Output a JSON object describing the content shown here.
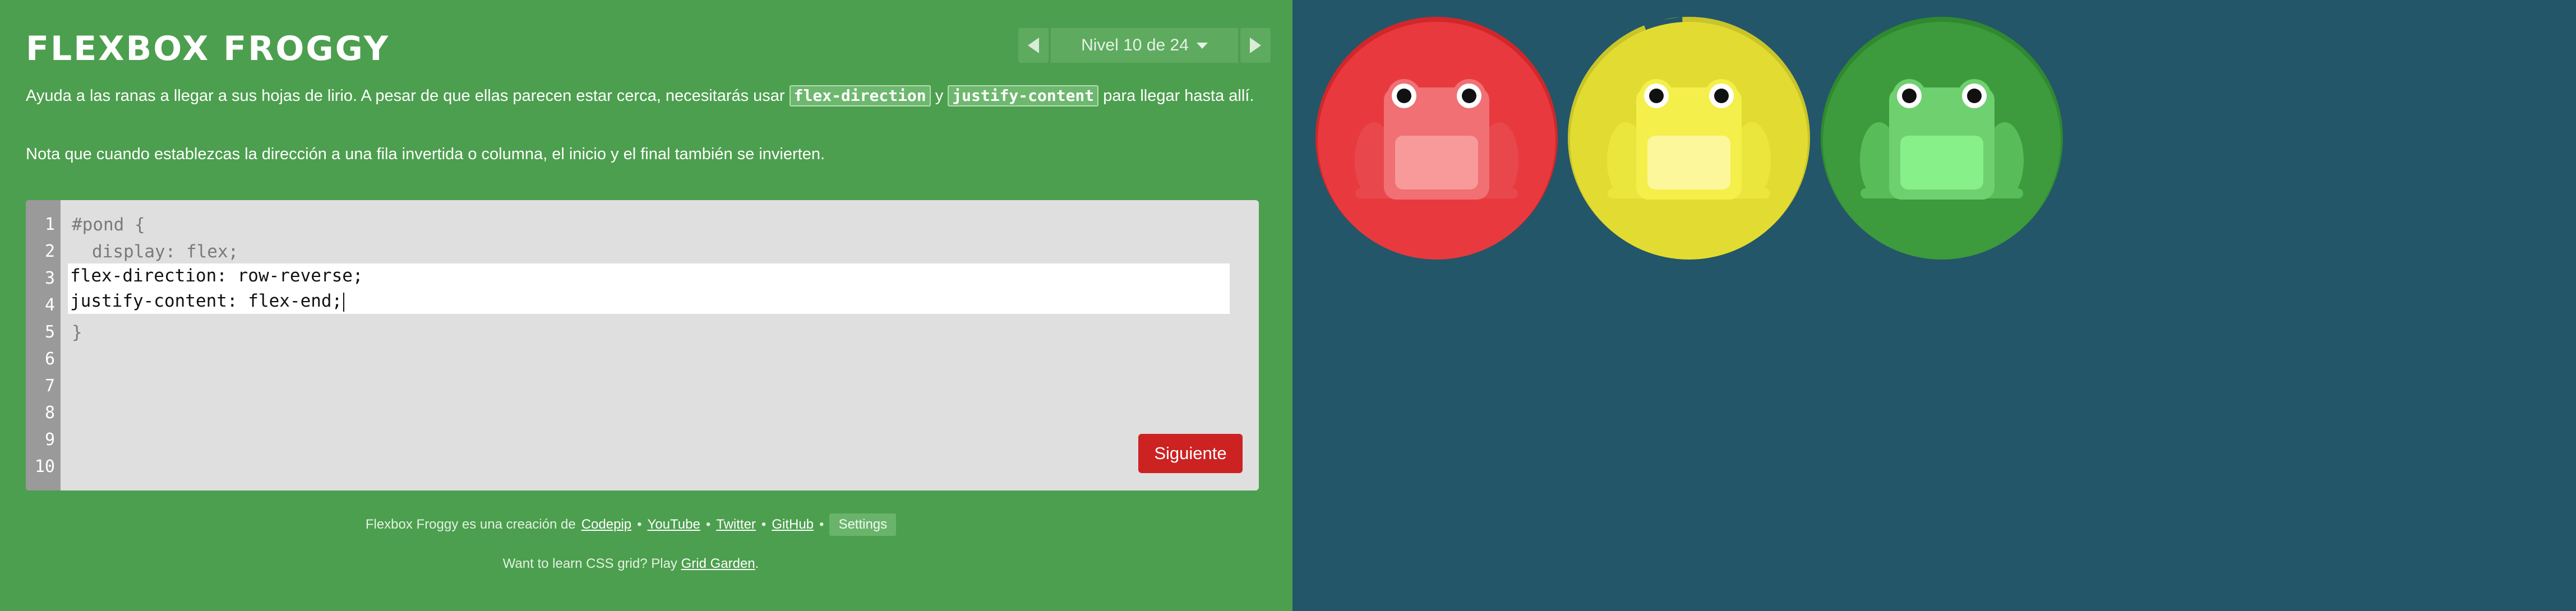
{
  "app": {
    "title": "FLEXBOX FROGGY"
  },
  "level_nav": {
    "label": "Nivel 10 de 24",
    "prev_icon": "triangle-left",
    "next_icon": "triangle-right"
  },
  "instructions": {
    "p1_before": "Ayuda a las ranas a llegar a sus hojas de lirio. A pesar de que ellas parecen estar cerca, necesitarás usar ",
    "code1": "flex-direction",
    "p1_mid": " y ",
    "code2": "justify-content",
    "p1_after": " para llegar hasta allí.",
    "p2": "Nota que cuando establezcas la dirección a una fila invertida o columna, el inicio y el final también se invierten."
  },
  "editor": {
    "line_numbers": [
      "1",
      "2",
      "3",
      "4",
      "5",
      "6",
      "7",
      "8",
      "9",
      "10"
    ],
    "line1": "#pond {",
    "line2": "display: flex;",
    "line5": "}",
    "input_line1": "flex-direction: row-reverse;",
    "input_line2": "justify-content: flex-end;",
    "next_label": "Siguiente"
  },
  "footer": {
    "credit_text": "Flexbox Froggy es una creación de",
    "link_codepip": "Codepip",
    "link_youtube": "YouTube",
    "link_twitter": "Twitter",
    "link_github": "GitHub",
    "separator": "•",
    "settings_label": "Settings",
    "promo_text": "Want to learn CSS grid? Play",
    "promo_link": "Grid Garden",
    "promo_end": "."
  },
  "colors": {
    "sidebar_bg": "#4c9f4e",
    "board_bg": "#235669",
    "next_button": "#cc2222",
    "pad_red": "#d2272a",
    "pad_yellow": "#c9c42a",
    "pad_green": "#2f8a2f"
  },
  "board": {
    "frogs": [
      {
        "color": "red",
        "icon": "frog-red-icon"
      },
      {
        "color": "yellow",
        "icon": "frog-yellow-icon"
      },
      {
        "color": "green",
        "icon": "frog-green-icon"
      }
    ],
    "lilypads": [
      {
        "color": "red",
        "icon": "lilypad-red-icon"
      },
      {
        "color": "yellow",
        "icon": "lilypad-yellow-icon"
      },
      {
        "color": "green",
        "icon": "lilypad-green-icon"
      }
    ]
  }
}
